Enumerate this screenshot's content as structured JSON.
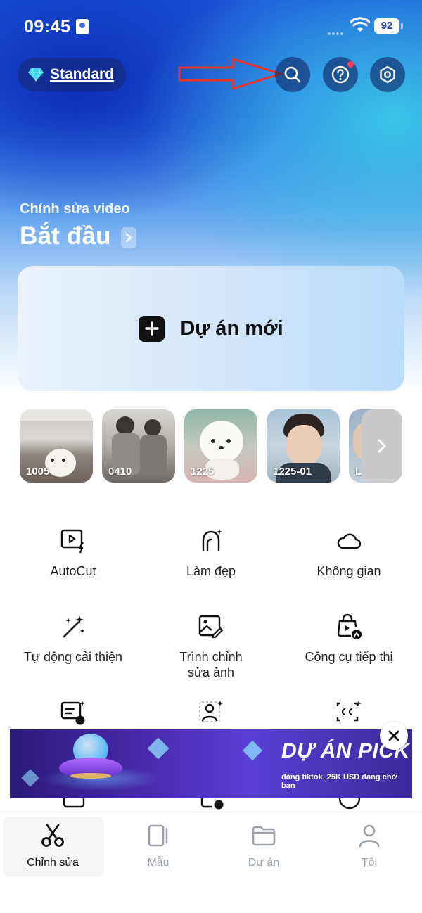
{
  "status_bar": {
    "time": "09:45",
    "battery": "92"
  },
  "header": {
    "plan_label": "Standard",
    "icons": [
      "diamond-icon",
      "search-icon",
      "help-icon",
      "settings-icon"
    ]
  },
  "section": {
    "subtitle": "Chỉnh sửa video",
    "title": "Bắt đầu"
  },
  "new_project": {
    "label": "Dự án mới"
  },
  "recent_projects": [
    {
      "label": "1005"
    },
    {
      "label": "0410"
    },
    {
      "label": "1225"
    },
    {
      "label": "1225-01"
    },
    {
      "label": "L"
    }
  ],
  "tools": [
    {
      "label": "AutoCut",
      "icon": "autocut-icon"
    },
    {
      "label": "Làm đẹp",
      "icon": "beauty-icon"
    },
    {
      "label": "Không gian",
      "icon": "cloud-icon"
    },
    {
      "label": "Tự động cải thiện",
      "icon": "magic-wand-icon"
    },
    {
      "label": "Trình chỉnh sửa ảnh",
      "icon": "photo-editor-icon"
    },
    {
      "label": "Công cụ tiếp thị",
      "icon": "marketing-icon"
    }
  ],
  "ad": {
    "title": "DỰ ÁN PICK",
    "subtitle": "đăng tiktok, 25K USD đang chờ bạn"
  },
  "tabs": [
    {
      "label": "Chỉnh sửa",
      "icon": "scissors-icon"
    },
    {
      "label": "Mẫu",
      "icon": "template-icon"
    },
    {
      "label": "Dự án",
      "icon": "folder-icon"
    },
    {
      "label": "Tôi",
      "icon": "profile-icon"
    }
  ],
  "colors": {
    "accent": "#1a52d8",
    "notification": "#ff3b4e",
    "annotation_arrow": "#e8332a"
  }
}
